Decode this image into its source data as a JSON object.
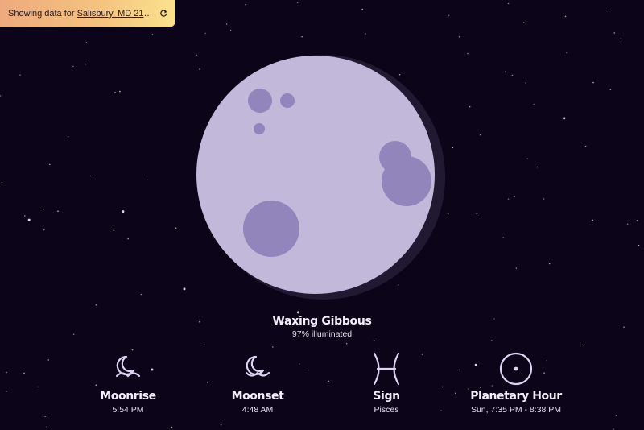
{
  "colors": {
    "sky": "#0c0418",
    "moon_lit": "#c2b8da",
    "moon_crater": "#9185bc",
    "moon_shadow": "#211932",
    "icon_stroke": "#ddd4f4"
  },
  "location_bar": {
    "prefix": "Showing data for",
    "location": "Salisbury, MD 21804...",
    "refresh_icon": "refresh-icon"
  },
  "moon": {
    "phase": "Waxing Gibbous",
    "illumination_text": "97% illuminated",
    "illumination": 0.97
  },
  "stats": [
    {
      "icon": "moonrise-icon",
      "label": "Moonrise",
      "value": "5:54 PM"
    },
    {
      "icon": "moonset-icon",
      "label": "Moonset",
      "value": "4:48 AM"
    },
    {
      "icon": "pisces-icon",
      "label": "Sign",
      "value": "Pisces"
    },
    {
      "icon": "sun-symbol-icon",
      "label": "Planetary Hour",
      "value": "Sun, 7:35 PM - 8:38 PM"
    }
  ]
}
